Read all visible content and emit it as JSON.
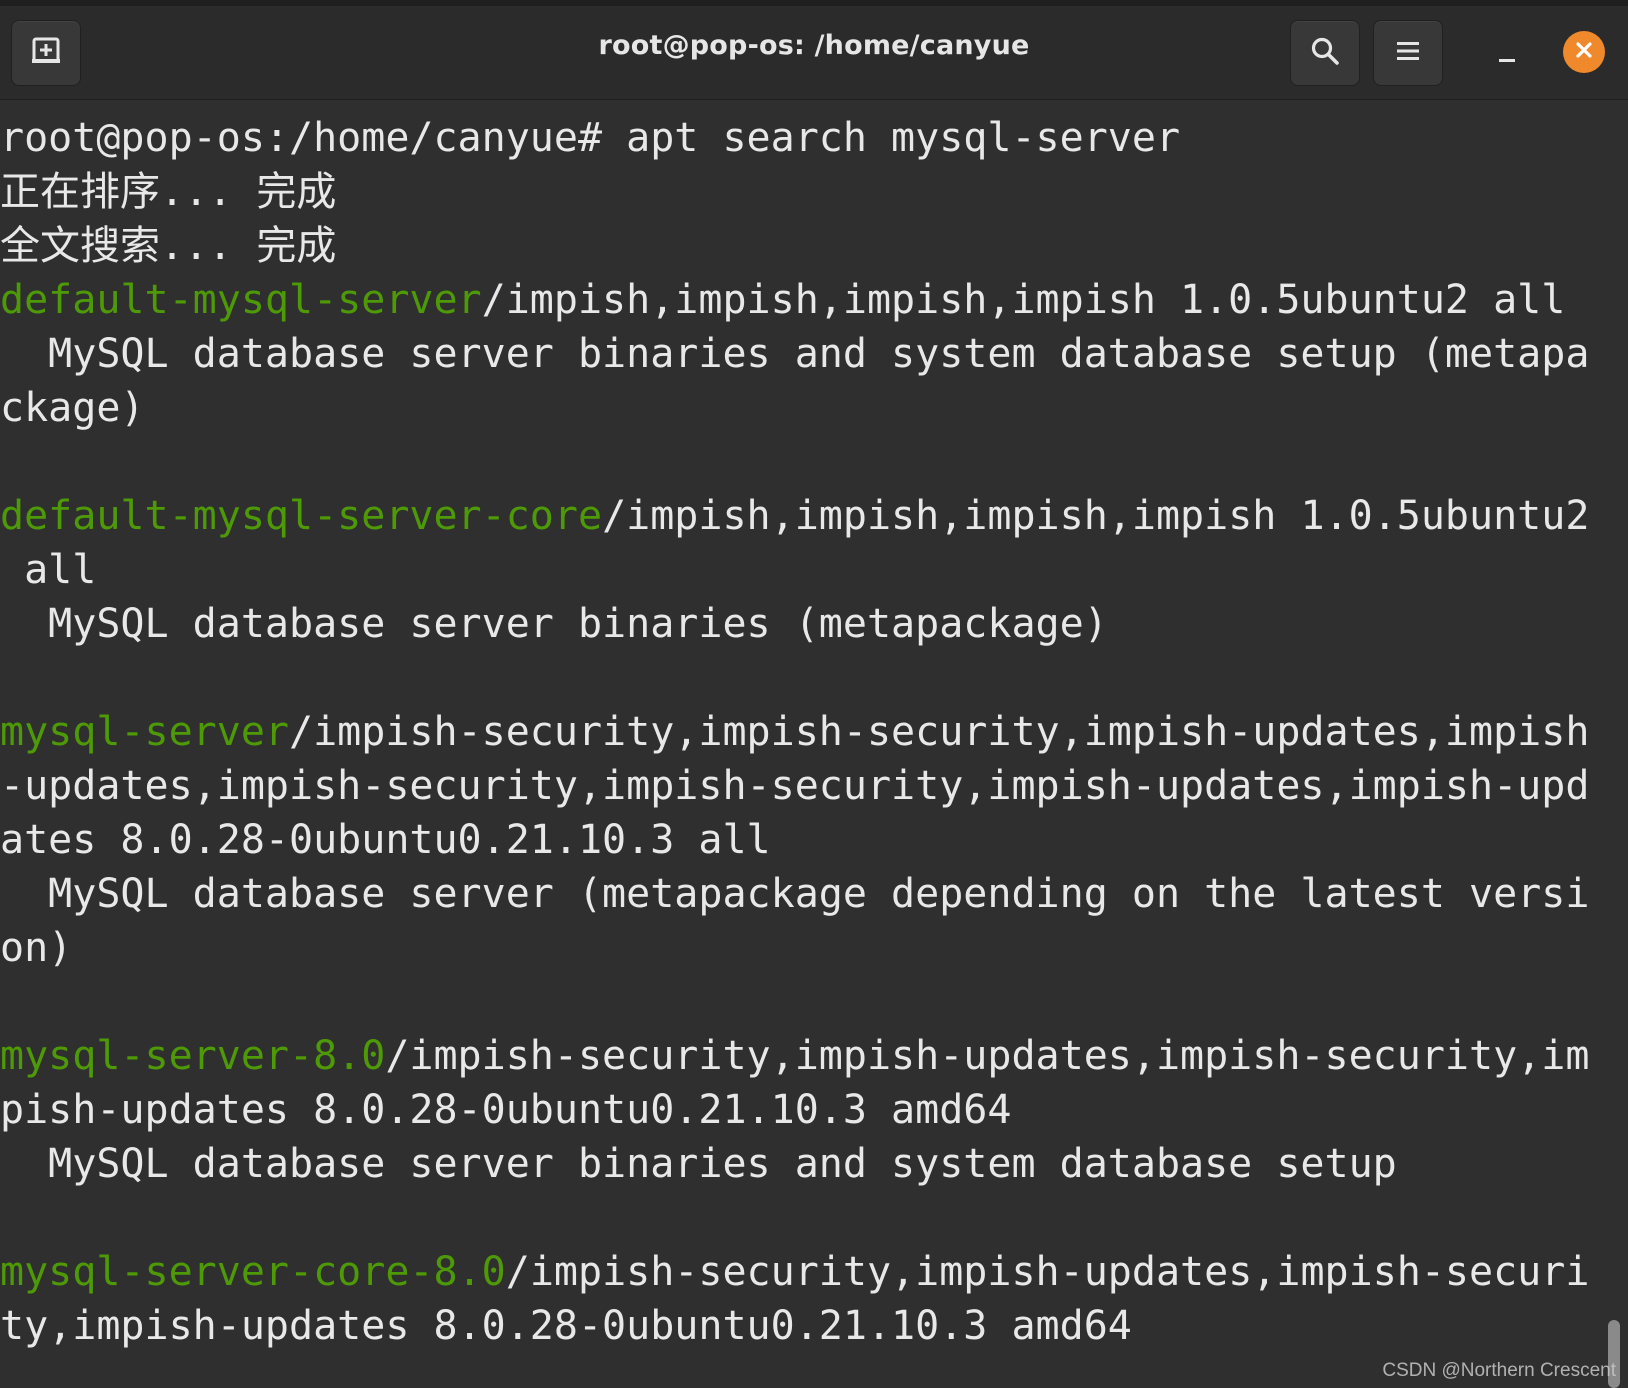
{
  "window": {
    "title": "root@pop-os: /home/canyue"
  },
  "toolbar": {
    "icons": [
      "new-tab-icon",
      "search-icon",
      "hamburger-menu-icon",
      "minimize-icon",
      "close-icon"
    ]
  },
  "colors": {
    "background": "#2f2f2f",
    "titlebar": "#2b2b2b",
    "text": "#e8e8e8",
    "package_name": "#4e9a06",
    "close_button": "#f0892b"
  },
  "terminal": {
    "lines": [
      [
        {
          "t": "root@pop-os:/home/canyue# apt search mysql-server"
        }
      ],
      [
        {
          "t": "正在排序... 完成"
        }
      ],
      [
        {
          "t": "全文搜索... 完成"
        }
      ],
      [
        {
          "t": "default-mysql-server",
          "c": "pkg"
        },
        {
          "t": "/impish,impish,impish,impish 1.0.5ubuntu2 all"
        }
      ],
      [
        {
          "t": "  MySQL database server binaries and system database setup (metapa"
        }
      ],
      [
        {
          "t": "ckage)"
        }
      ],
      [
        {
          "t": ""
        }
      ],
      [
        {
          "t": "default-mysql-server-core",
          "c": "pkg"
        },
        {
          "t": "/impish,impish,impish,impish 1.0.5ubuntu2"
        }
      ],
      [
        {
          "t": " all"
        }
      ],
      [
        {
          "t": "  MySQL database server binaries (metapackage)"
        }
      ],
      [
        {
          "t": ""
        }
      ],
      [
        {
          "t": "mysql-server",
          "c": "pkg"
        },
        {
          "t": "/impish-security,impish-security,impish-updates,impish"
        }
      ],
      [
        {
          "t": "-updates,impish-security,impish-security,impish-updates,impish-upd"
        }
      ],
      [
        {
          "t": "ates 8.0.28-0ubuntu0.21.10.3 all"
        }
      ],
      [
        {
          "t": "  MySQL database server (metapackage depending on the latest versi"
        }
      ],
      [
        {
          "t": "on)"
        }
      ],
      [
        {
          "t": ""
        }
      ],
      [
        {
          "t": "mysql-server-8.0",
          "c": "pkg"
        },
        {
          "t": "/impish-security,impish-updates,impish-security,im"
        }
      ],
      [
        {
          "t": "pish-updates 8.0.28-0ubuntu0.21.10.3 amd64"
        }
      ],
      [
        {
          "t": "  MySQL database server binaries and system database setup"
        }
      ],
      [
        {
          "t": ""
        }
      ],
      [
        {
          "t": "mysql-server-core-8.0",
          "c": "pkg"
        },
        {
          "t": "/impish-security,impish-updates,impish-securi"
        }
      ],
      [
        {
          "t": "ty,impish-updates 8.0.28-0ubuntu0.21.10.3 amd64"
        }
      ]
    ]
  },
  "watermark": "CSDN @Northern   Crescent"
}
